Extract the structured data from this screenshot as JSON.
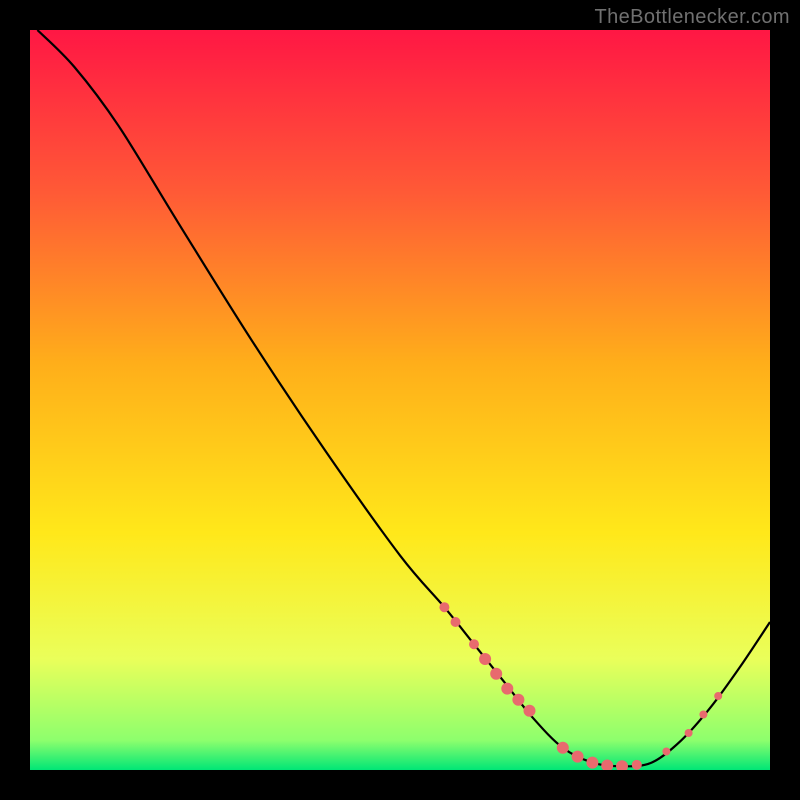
{
  "credit": "TheBottlenecker.com",
  "chart_data": {
    "type": "line",
    "title": "",
    "xlabel": "",
    "ylabel": "",
    "xlim": [
      0,
      100
    ],
    "ylim": [
      0,
      100
    ],
    "gradient_stops": [
      {
        "pct": 0,
        "color": "#ff1744"
      },
      {
        "pct": 22,
        "color": "#ff5a36"
      },
      {
        "pct": 45,
        "color": "#ffae1a"
      },
      {
        "pct": 68,
        "color": "#ffe81a"
      },
      {
        "pct": 85,
        "color": "#eaff5a"
      },
      {
        "pct": 96,
        "color": "#8dff6d"
      },
      {
        "pct": 100,
        "color": "#00e676"
      }
    ],
    "curve": [
      {
        "x": 1,
        "y": 100
      },
      {
        "x": 6,
        "y": 95
      },
      {
        "x": 12,
        "y": 87
      },
      {
        "x": 20,
        "y": 74
      },
      {
        "x": 30,
        "y": 58
      },
      {
        "x": 40,
        "y": 43
      },
      {
        "x": 50,
        "y": 29
      },
      {
        "x": 56,
        "y": 22
      },
      {
        "x": 60,
        "y": 17
      },
      {
        "x": 64,
        "y": 12
      },
      {
        "x": 68,
        "y": 7
      },
      {
        "x": 72,
        "y": 3
      },
      {
        "x": 76,
        "y": 1
      },
      {
        "x": 80,
        "y": 0.5
      },
      {
        "x": 84,
        "y": 1
      },
      {
        "x": 88,
        "y": 4
      },
      {
        "x": 92,
        "y": 8.5
      },
      {
        "x": 96,
        "y": 14
      },
      {
        "x": 100,
        "y": 20
      }
    ],
    "dots": [
      {
        "x": 56,
        "y": 22,
        "r": 5
      },
      {
        "x": 57.5,
        "y": 20,
        "r": 5
      },
      {
        "x": 60,
        "y": 17,
        "r": 5
      },
      {
        "x": 61.5,
        "y": 15,
        "r": 6
      },
      {
        "x": 63,
        "y": 13,
        "r": 6
      },
      {
        "x": 64.5,
        "y": 11,
        "r": 6
      },
      {
        "x": 66,
        "y": 9.5,
        "r": 6
      },
      {
        "x": 67.5,
        "y": 8,
        "r": 6
      },
      {
        "x": 72,
        "y": 3,
        "r": 6
      },
      {
        "x": 74,
        "y": 1.8,
        "r": 6
      },
      {
        "x": 76,
        "y": 1,
        "r": 6
      },
      {
        "x": 78,
        "y": 0.6,
        "r": 6
      },
      {
        "x": 80,
        "y": 0.5,
        "r": 6
      },
      {
        "x": 82,
        "y": 0.7,
        "r": 5
      },
      {
        "x": 86,
        "y": 2.5,
        "r": 4
      },
      {
        "x": 89,
        "y": 5,
        "r": 4
      },
      {
        "x": 91,
        "y": 7.5,
        "r": 4
      },
      {
        "x": 93,
        "y": 10,
        "r": 4
      }
    ],
    "dot_color": "#e86a6e",
    "curve_color": "#000000"
  }
}
